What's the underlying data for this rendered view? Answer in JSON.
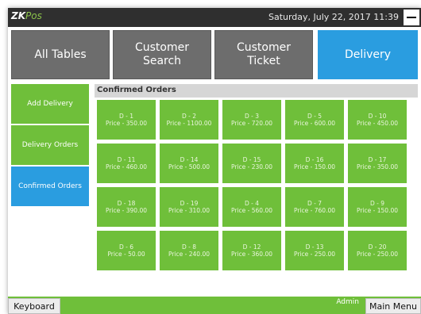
{
  "app": {
    "logo_main": "ZK",
    "logo_suffix": "Pos",
    "datetime": "Saturday, July 22, 2017 11:39"
  },
  "tabs": [
    {
      "label": "All Tables",
      "style": "gray"
    },
    {
      "label": "Customer\nSearch",
      "style": "gray"
    },
    {
      "label": "Customer\nTicket",
      "style": "gray"
    },
    {
      "label": "Delivery",
      "style": "blue",
      "active": true
    }
  ],
  "sidebar": [
    {
      "label": "Add Delivery"
    },
    {
      "label": "Delivery Orders"
    },
    {
      "label": "Confirmed Orders",
      "active": true
    }
  ],
  "orders": {
    "title": "Confirmed Orders",
    "items": [
      {
        "id": "D - 1",
        "price": "Price - 350.00"
      },
      {
        "id": "D - 2",
        "price": "Price - 1100.00"
      },
      {
        "id": "D - 3",
        "price": "Price - 720.00"
      },
      {
        "id": "D - 5",
        "price": "Price - 600.00"
      },
      {
        "id": "D - 10",
        "price": "Price - 450.00"
      },
      {
        "id": "D - 11",
        "price": "Price - 460.00"
      },
      {
        "id": "D - 14",
        "price": "Price - 500.00"
      },
      {
        "id": "D - 15",
        "price": "Price - 230.00"
      },
      {
        "id": "D - 16",
        "price": "Price - 150.00"
      },
      {
        "id": "D - 17",
        "price": "Price - 350.00"
      },
      {
        "id": "D - 18",
        "price": "Price - 390.00"
      },
      {
        "id": "D - 19",
        "price": "Price - 310.00"
      },
      {
        "id": "D - 4",
        "price": "Price - 560.00"
      },
      {
        "id": "D - 7",
        "price": "Price - 760.00"
      },
      {
        "id": "D - 9",
        "price": "Price - 150.00"
      },
      {
        "id": "D - 6",
        "price": "Price - 50.00"
      },
      {
        "id": "D - 8",
        "price": "Price - 240.00"
      },
      {
        "id": "D - 12",
        "price": "Price - 360.00"
      },
      {
        "id": "D - 13",
        "price": "Price - 250.00"
      },
      {
        "id": "D - 20",
        "price": "Price - 250.00"
      }
    ]
  },
  "footer": {
    "keyboard_label": "Keyboard",
    "user_label": "Admin",
    "main_menu_label": "Main Menu"
  },
  "colors": {
    "green": "#6fbf3a",
    "blue": "#2a9de0",
    "gray": "#6d6d6d",
    "topbar": "#2f2f2f"
  },
  "icons": {
    "minimize": "minimize-icon"
  }
}
